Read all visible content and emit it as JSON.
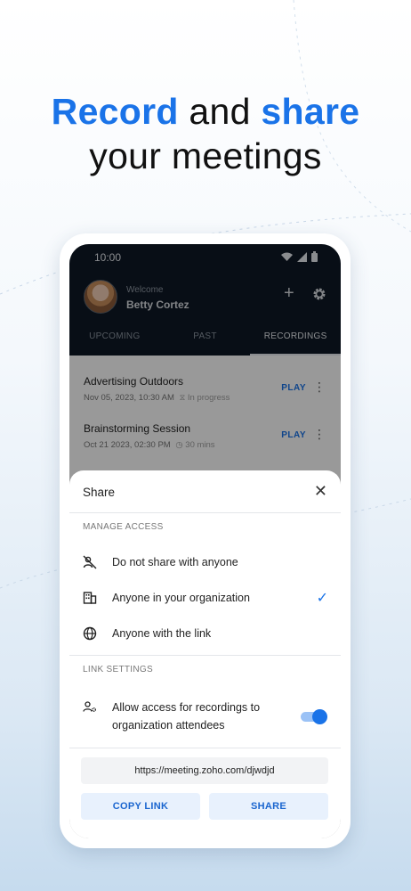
{
  "headline": {
    "word1": "Record",
    "word2": " and ",
    "word3": "share",
    "line2": "your meetings"
  },
  "colors": {
    "accent": "#1a73e8",
    "app_header": "#0e1825"
  },
  "status_bar": {
    "time": "10:00",
    "icons": [
      "wifi-icon",
      "signal-icon",
      "battery-icon"
    ]
  },
  "profile": {
    "greeting": "Welcome",
    "name": "Betty Cortez"
  },
  "header_actions": [
    "add-icon",
    "gear-icon"
  ],
  "tabs": [
    {
      "label": "UPCOMING",
      "active": false
    },
    {
      "label": "PAST",
      "active": false
    },
    {
      "label": "RECORDINGS",
      "active": true
    }
  ],
  "recordings": [
    {
      "title": "Advertising Outdoors",
      "date": "Nov 05, 2023, 10:30 AM",
      "extra": "In progress",
      "action": "PLAY"
    },
    {
      "title": "Brainstorming Session",
      "date": "Oct 21 2023, 02:30 PM",
      "extra": "30 mins",
      "action": "PLAY"
    }
  ],
  "share_sheet": {
    "title": "Share",
    "manage_access_label": "MANAGE ACCESS",
    "options": [
      {
        "label": "Do not share with anyone",
        "icon": "no-share-icon",
        "selected": false
      },
      {
        "label": "Anyone in your organization",
        "icon": "building-icon",
        "selected": true
      },
      {
        "label": "Anyone with the link",
        "icon": "globe-icon",
        "selected": false
      }
    ],
    "link_settings_label": "LINK SETTINGS",
    "allow_access": {
      "label": "Allow access for recordings to organization attendees",
      "enabled": true
    },
    "link_url": "https://meeting.zoho.com/djwdjd",
    "copy_button": "COPY LINK",
    "share_button": "SHARE"
  }
}
